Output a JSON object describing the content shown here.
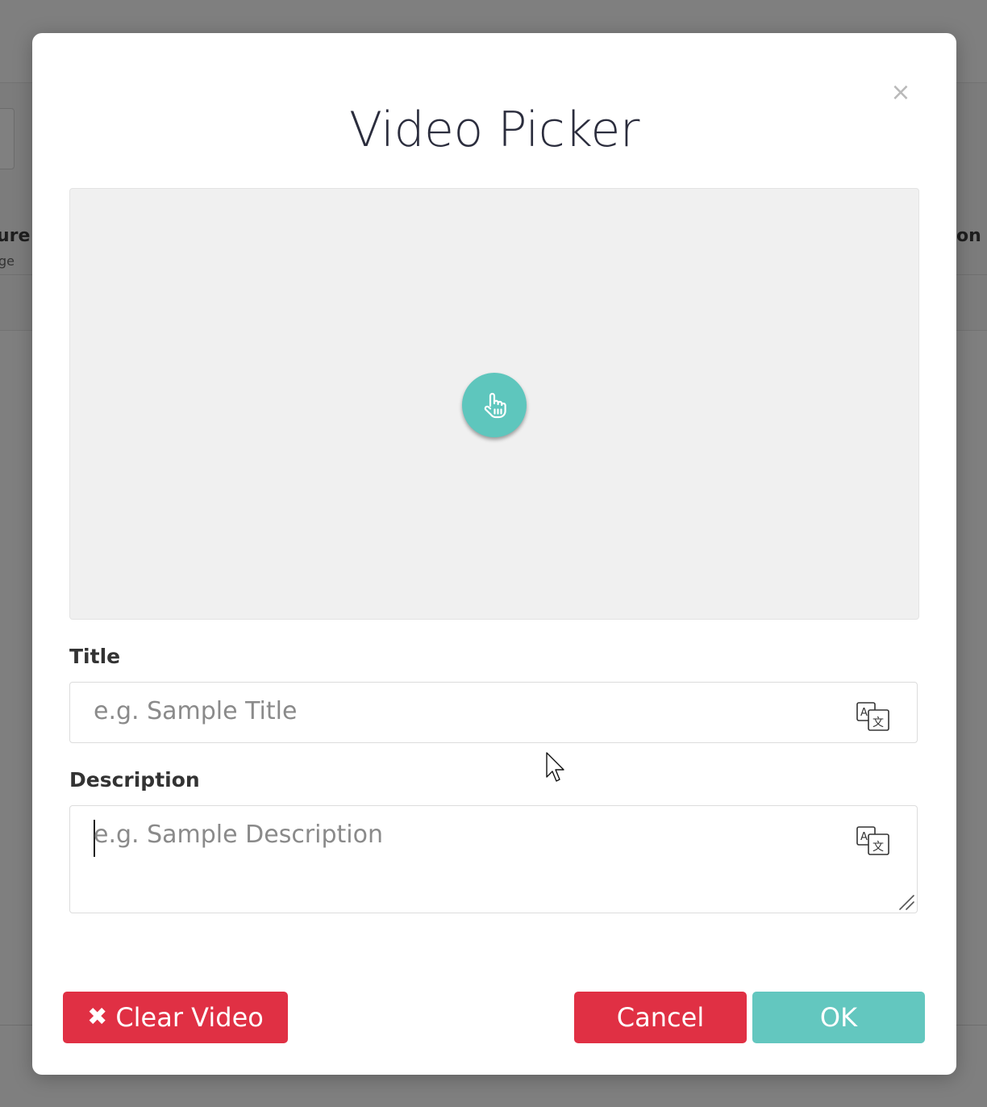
{
  "background": {
    "fragment_left_title": "ure",
    "fragment_left_subtitle": "ge",
    "fragment_right_title": "on"
  },
  "modal": {
    "title": "Video Picker",
    "close_label": "×",
    "video_area": {
      "pick_icon": "hand-pointer-icon"
    },
    "title_field": {
      "label": "Title",
      "value": "",
      "placeholder": "e.g. Sample Title",
      "translate_icon": "translate-icon"
    },
    "description_field": {
      "label": "Description",
      "value": "",
      "placeholder": "e.g. Sample Description",
      "translate_icon": "translate-icon"
    },
    "buttons": {
      "clear_icon": "✖",
      "clear_label": "Clear Video",
      "cancel_label": "Cancel",
      "ok_label": "OK"
    }
  },
  "colors": {
    "accent_teal": "#5ec6bd",
    "danger_red": "#e03044",
    "overlay_gray": "#7f7f7f"
  }
}
